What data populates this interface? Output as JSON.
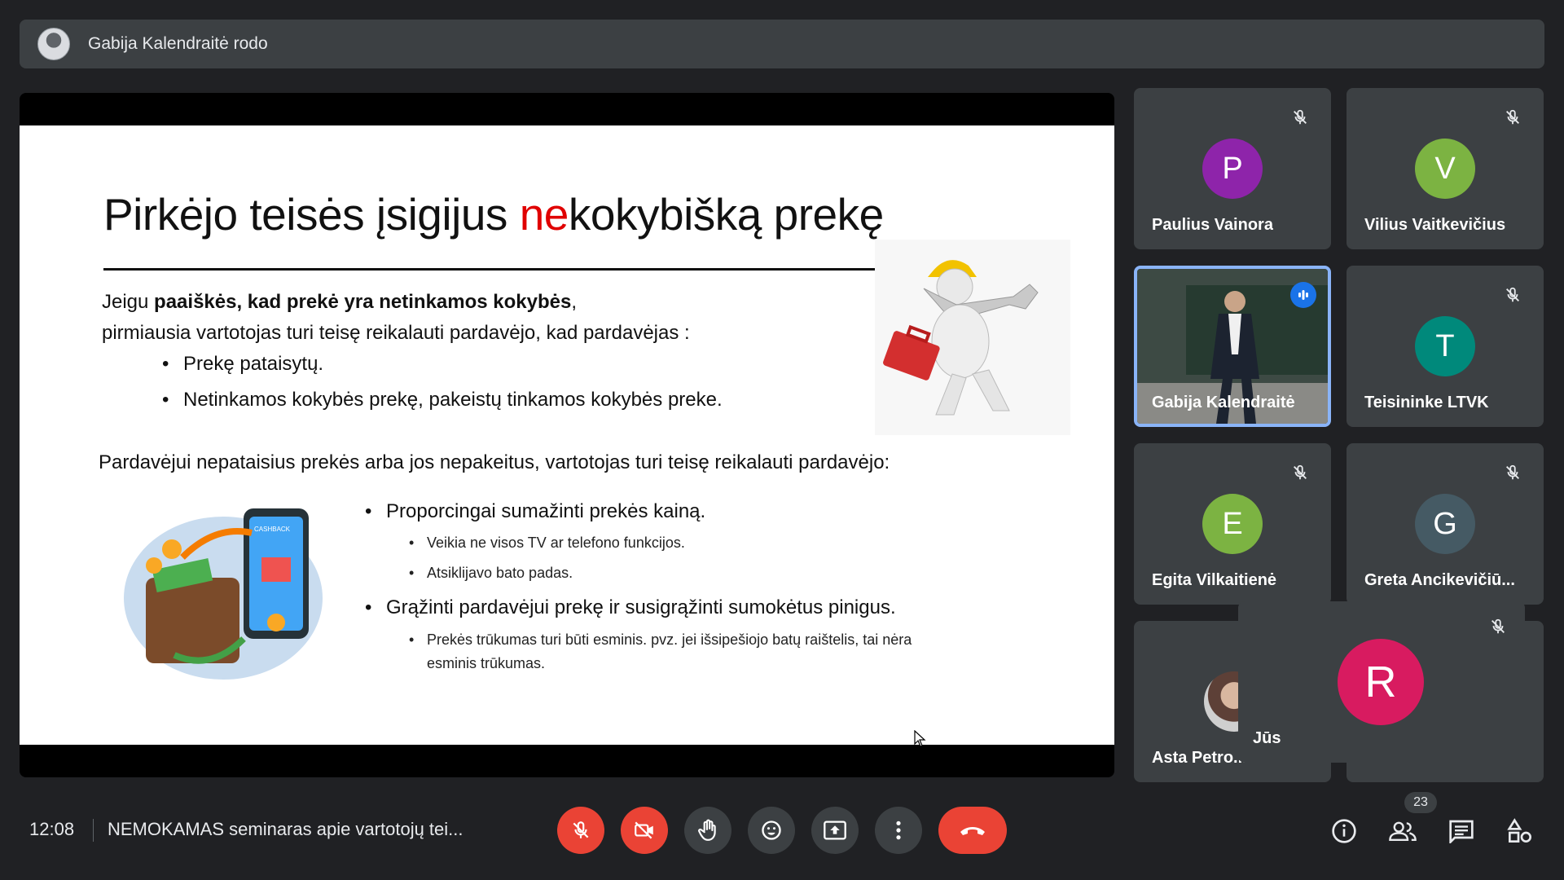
{
  "presenting_bar": {
    "text": "Gabija Kalendraitė rodo"
  },
  "slide": {
    "title_part1": "Pirkėjo teisės įsigijus ",
    "title_neg": "ne",
    "title_part2": "kokybišką prekę",
    "line1_prefix": "Jeigu ",
    "line1_bold": "paaiškės, kad prekė yra netinkamos kokybės",
    "line1_suffix": ",",
    "line2": "pirmiausia vartotojas turi teisę reikalauti pardavėjo, kad pardavėjas :",
    "bullets_a": [
      "Prekę pataisytų.",
      "Netinkamos kokybės prekę, pakeistų tinkamos kokybės preke."
    ],
    "line3": "Pardavėjui nepataisius prekės arba jos nepakeitus, vartotojas turi teisę reikalauti pardavėjo:",
    "bullet_b1": "Proporcingai sumažinti prekės kainą.",
    "sub_b1": [
      "Veikia ne visos TV ar telefono funkcijos.",
      "Atsiklijavo bato padas."
    ],
    "bullet_b2": "Grąžinti pardavėjui prekę ir susigrąžinti sumokėtus pinigus.",
    "sub_b2_line1": "Prekės trūkumas turi būti esminis. pvz. jei išsipešiojo batų raištelis, tai nėra",
    "sub_b2_line2": "esminis trūkumas.",
    "phone_text": "CASHBACK"
  },
  "participants": [
    {
      "name": "Paulius Vainora",
      "initial": "P",
      "color": "#8e24aa",
      "muted": true
    },
    {
      "name": "Vilius Vaitkevičius",
      "initial": "V",
      "color": "#7cb342",
      "muted": true
    },
    {
      "name": "Gabija Kalendraitė",
      "initial": "",
      "color": "",
      "muted": false,
      "speaking": true
    },
    {
      "name": "Teisininke LTVK",
      "initial": "T",
      "color": "#00897b",
      "muted": true
    },
    {
      "name": "Egita Vilkaitienė",
      "initial": "E",
      "color": "#7cb342",
      "muted": true
    },
    {
      "name": "Greta Ancikevičiū...",
      "initial": "G",
      "color": "#455a64",
      "muted": true
    },
    {
      "name": "Asta Petro...",
      "initial": "",
      "color": "",
      "muted": false
    }
  ],
  "self_tile": {
    "name": "Jūs",
    "initial": "R",
    "color": "#d81b60",
    "muted": true
  },
  "bottom_bar": {
    "time": "12:08",
    "meeting_title": "NEMOKAMAS seminaras apie vartotojų tei...",
    "participant_count": "23"
  }
}
